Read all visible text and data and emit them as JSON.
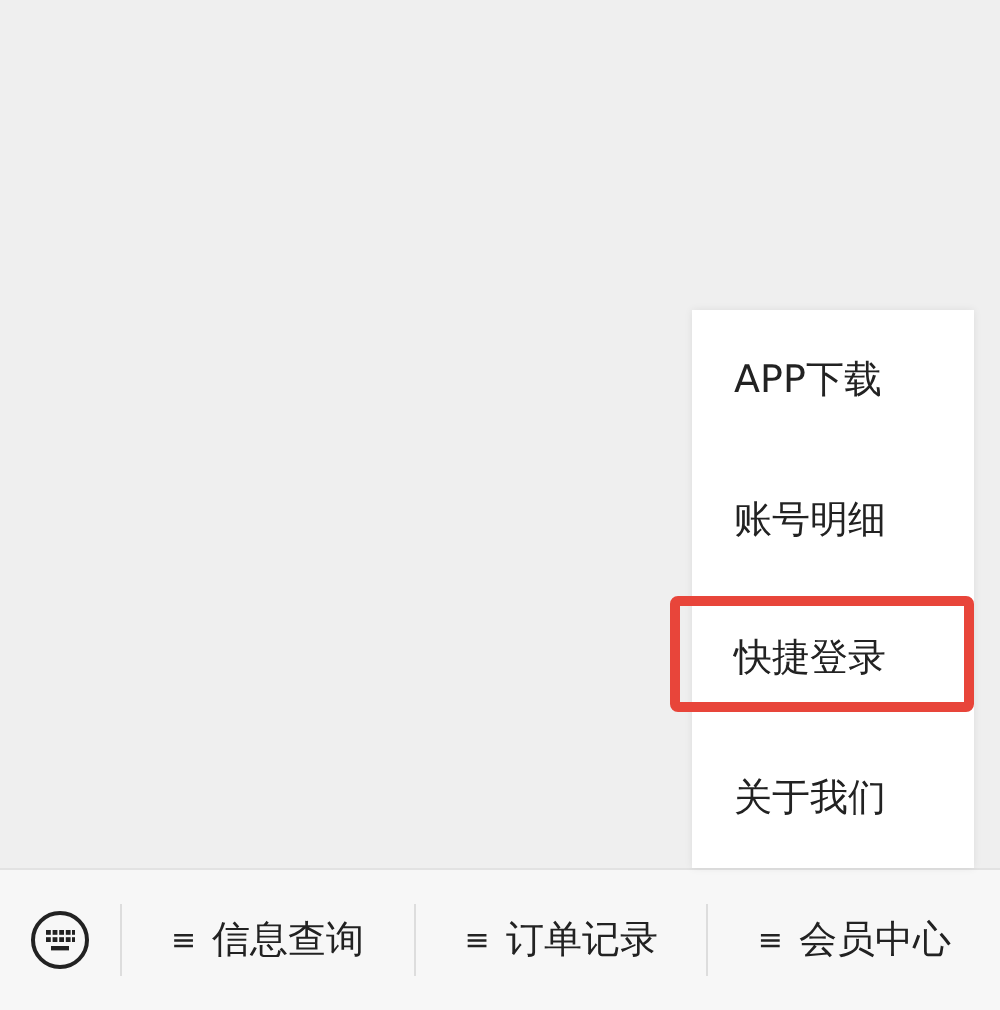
{
  "popup_menu": {
    "items": [
      {
        "label": "APP下载",
        "highlighted": false
      },
      {
        "label": "账号明细",
        "highlighted": false
      },
      {
        "label": "快捷登录",
        "highlighted": true
      },
      {
        "label": "关于我们",
        "highlighted": false
      }
    ]
  },
  "bottom_menu": {
    "items": [
      {
        "glyph": "≡",
        "label": "信息查询"
      },
      {
        "glyph": "≡",
        "label": "订单记录"
      },
      {
        "glyph": "≡",
        "label": "会员中心"
      }
    ]
  }
}
